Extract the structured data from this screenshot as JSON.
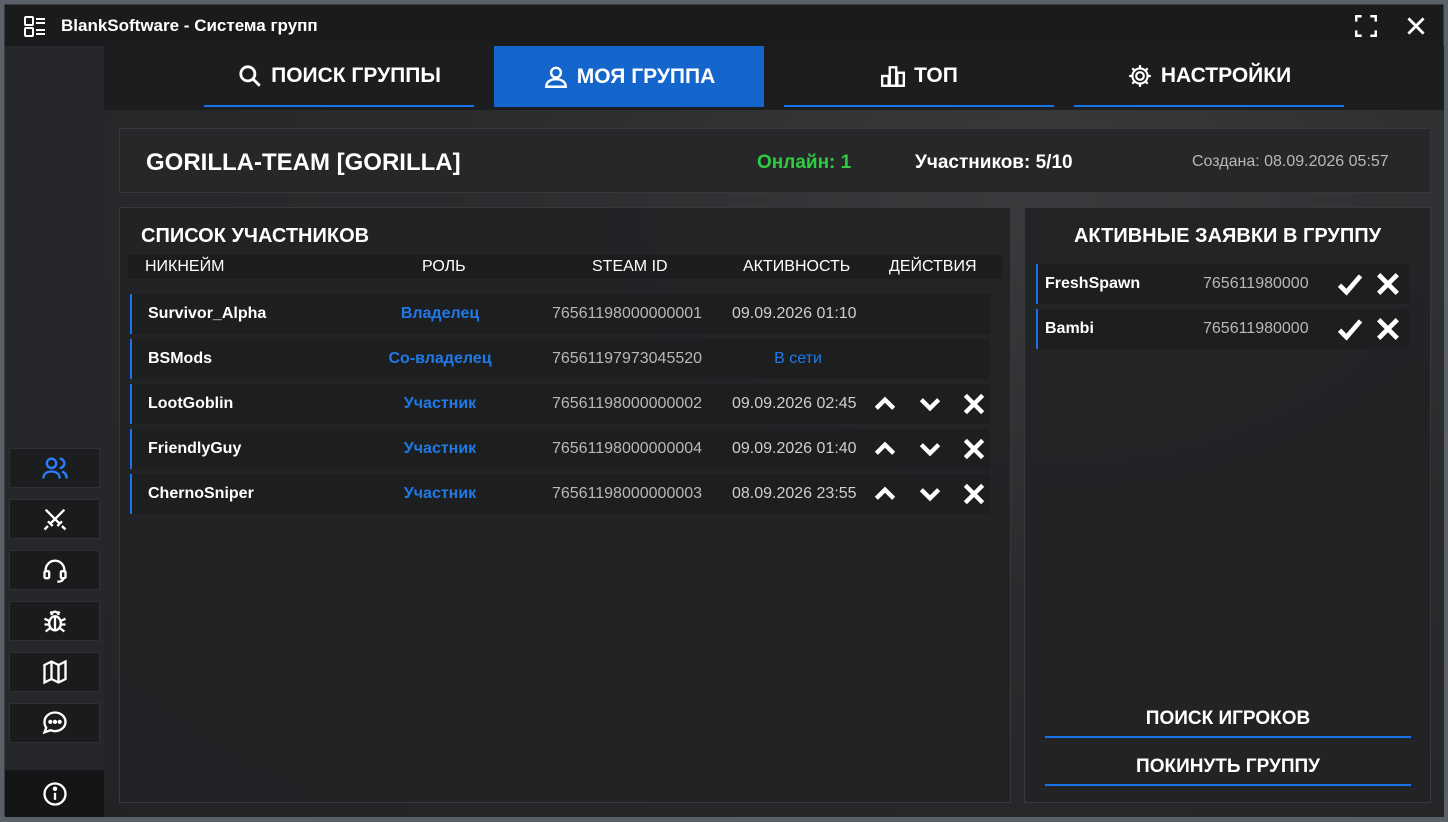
{
  "window": {
    "title": "BlankSoftware - Система групп"
  },
  "tabs": [
    {
      "label": "ПОИСК ГРУППЫ",
      "icon": "search-icon"
    },
    {
      "label": "МОЯ ГРУППА",
      "icon": "user-icon",
      "active": true
    },
    {
      "label": "ТОП",
      "icon": "chart-bars-icon"
    },
    {
      "label": "НАСТРОЙКИ",
      "icon": "gear-icon"
    }
  ],
  "sidebar": {
    "items": [
      {
        "icon": "users-icon",
        "active": true
      },
      {
        "icon": "crossed-swords-icon"
      },
      {
        "icon": "headset-icon"
      },
      {
        "icon": "bug-icon"
      },
      {
        "icon": "map-icon"
      },
      {
        "icon": "chat-icon"
      }
    ],
    "info_icon": "info-icon"
  },
  "group": {
    "name": "GORILLA-TEAM [GORILLA]",
    "online": "Онлайн: 1",
    "members": "Участников: 5/10",
    "created": "Создана: 08.09.2026 05:57"
  },
  "members_panel": {
    "title": "СПИСОК УЧАСТНИКОВ",
    "columns": [
      "НИКНЕЙМ",
      "РОЛЬ",
      "STEAM ID",
      "АКТИВНОСТЬ",
      "ДЕЙСТВИЯ"
    ],
    "rows": [
      {
        "nick": "Survivor_Alpha",
        "role": "Владелец",
        "steam": "76561198000000001",
        "activity": "09.09.2026 01:10",
        "actions": false
      },
      {
        "nick": "BSMods",
        "role": "Со-владелец",
        "steam": "76561197973045520",
        "activity": "В сети",
        "online": true,
        "actions": false
      },
      {
        "nick": "LootGoblin",
        "role": "Участник",
        "steam": "76561198000000002",
        "activity": "09.09.2026 02:45",
        "actions": true
      },
      {
        "nick": "FriendlyGuy",
        "role": "Участник",
        "steam": "76561198000000004",
        "activity": "09.09.2026 01:40",
        "actions": true
      },
      {
        "nick": "ChernoSniper",
        "role": "Участник",
        "steam": "76561198000000003",
        "activity": "08.09.2026 23:55",
        "actions": true
      }
    ]
  },
  "requests_panel": {
    "title": "АКТИВНЫЕ ЗАЯВКИ В ГРУППУ",
    "rows": [
      {
        "nick": "FreshSpawn",
        "id": "765611980000"
      },
      {
        "nick": "Bambi",
        "id": "765611980000"
      }
    ],
    "search_players_label": "ПОИСК ИГРОКОВ",
    "leave_group_label": "ПОКИНУТЬ ГРУППУ"
  },
  "colors": {
    "accent": "#1a73e8",
    "active_tab": "#1466cc",
    "online_green": "#2ecc40",
    "role_blue": "#1f7ae8"
  }
}
